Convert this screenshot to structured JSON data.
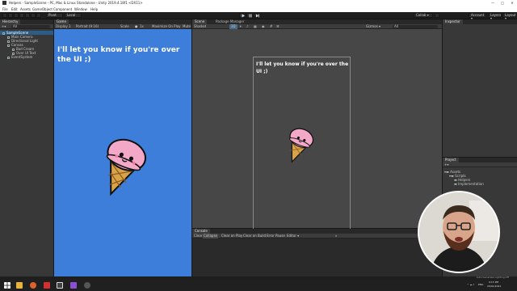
{
  "window": {
    "title": "Helpers - SampleScene - PC, Mac & Linux Standalone - Unity 2019.4.18f1 <DX11>",
    "controls": [
      "—",
      "□",
      "✕"
    ]
  },
  "menu": [
    "File",
    "Edit",
    "Assets",
    "GameObject",
    "Component",
    "Window",
    "Help"
  ],
  "toolbar": {
    "pivot": "Pivot",
    "local": "Local",
    "collab": "Collab ▾",
    "account": "Account ▾",
    "layers": "Layers ▾",
    "layout": "Layout ▾"
  },
  "hierarchy": {
    "tab": "Hierarchy",
    "search_placeholder": "All",
    "items": [
      {
        "label": "SampleScene",
        "indent": 0,
        "selected": true
      },
      {
        "label": "Main Camera",
        "indent": 1
      },
      {
        "label": "Directional Light",
        "indent": 1
      },
      {
        "label": "Canvas",
        "indent": 1
      },
      {
        "label": "Bad Cream",
        "indent": 2
      },
      {
        "label": "Over UI Text",
        "indent": 2
      },
      {
        "label": "EventSystem",
        "indent": 1
      }
    ]
  },
  "game": {
    "tab": "Game",
    "display": "Display 1",
    "resolution": "Portrait (9:16)",
    "scale_label": "Scale",
    "scale_value": "1x",
    "maximize": "Maximize On Play",
    "mute": "Mute",
    "text": "I'll let you know if you're over the UI ;)"
  },
  "scene": {
    "tabs": [
      "Scene",
      "Package Manager"
    ],
    "shading": "Shaded",
    "mode": "2D",
    "gizmos": "Gizmos ▾",
    "search": "All",
    "text": "I'll let you know if you're over the UI ;)"
  },
  "console": {
    "tab": "Console",
    "buttons": [
      "Clear",
      "Collapse",
      "Clear on Play",
      "Clear on Build",
      "Error Pause",
      "Editor ▾"
    ]
  },
  "inspector": {
    "tab": "Inspector"
  },
  "project": {
    "tab": "Project",
    "root": "Assets",
    "folders": [
      "Scripts",
      "Helpers",
      "Implementation"
    ]
  },
  "status": {
    "text": "Auto Generate Lighting Off"
  },
  "taskbar": {
    "lang": "ENG",
    "time": "9:15 PM",
    "date": "29/01/2021"
  },
  "colors": {
    "game_bg": "#3c7ed9",
    "selection": "#2c5d87",
    "ice_cream": "#f4a8c8",
    "cone": "#d9a34a"
  }
}
